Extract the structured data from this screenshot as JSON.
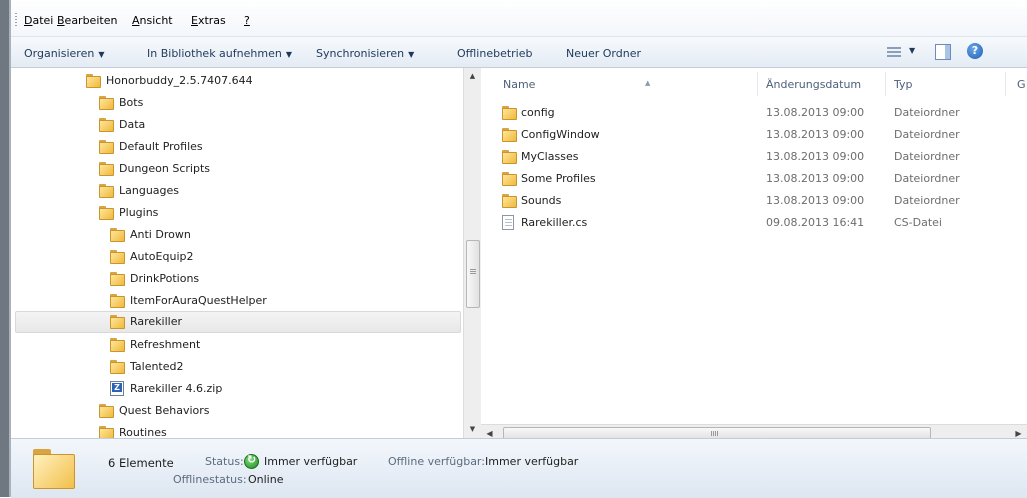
{
  "menubar": {
    "items": [
      {
        "label": "Datei",
        "ul": "D",
        "rest": "atei"
      },
      {
        "label": "Bearbeiten",
        "ul": "B",
        "rest": "earbeiten"
      },
      {
        "label": "Ansicht",
        "ul": "A",
        "rest": "nsicht"
      },
      {
        "label": "Extras",
        "ul": "E",
        "rest": "xtras"
      },
      {
        "label": "?",
        "ul": "?",
        "rest": ""
      }
    ]
  },
  "toolbar": {
    "organize": "Organisieren",
    "library": "In Bibliothek aufnehmen",
    "sync": "Synchronisieren",
    "offline": "Offlinebetrieb",
    "new_folder": "Neuer Ordner",
    "dropdown_arrow": "▼",
    "help": "?"
  },
  "tree": {
    "items": [
      {
        "label": "Honorbuddy_2.5.7407.644",
        "icon": "folder-icon"
      },
      {
        "label": "Bots",
        "icon": "folder-icon"
      },
      {
        "label": "Data",
        "icon": "folder-icon"
      },
      {
        "label": "Default Profiles",
        "icon": "folder-icon"
      },
      {
        "label": "Dungeon Scripts",
        "icon": "folder-icon"
      },
      {
        "label": "Languages",
        "icon": "folder-icon"
      },
      {
        "label": "Plugins",
        "icon": "folder-icon"
      },
      {
        "label": "Anti Drown",
        "icon": "folder-icon"
      },
      {
        "label": "AutoEquip2",
        "icon": "folder-icon"
      },
      {
        "label": "DrinkPotions",
        "icon": "folder-icon"
      },
      {
        "label": "ItemForAuraQuestHelper",
        "icon": "folder-icon"
      },
      {
        "label": "Rarekiller",
        "icon": "folder-icon",
        "selected": true
      },
      {
        "label": "Refreshment",
        "icon": "folder-icon"
      },
      {
        "label": "Talented2",
        "icon": "folder-icon"
      },
      {
        "label": "Rarekiller 4.6.zip",
        "icon": "zip-icon"
      },
      {
        "label": "Quest Behaviors",
        "icon": "folder-icon"
      },
      {
        "label": "Routines",
        "icon": "folder-icon"
      }
    ]
  },
  "details": {
    "columns": {
      "name": "Name",
      "date": "Änderungsdatum",
      "type": "Typ",
      "size": "G"
    },
    "rows": [
      {
        "name": "config",
        "date": "13.08.2013 09:00",
        "type": "Dateiordner",
        "icon": "folder-icon"
      },
      {
        "name": "ConfigWindow",
        "date": "13.08.2013 09:00",
        "type": "Dateiordner",
        "icon": "folder-icon"
      },
      {
        "name": "MyClasses",
        "date": "13.08.2013 09:00",
        "type": "Dateiordner",
        "icon": "folder-icon"
      },
      {
        "name": "Some Profiles",
        "date": "13.08.2013 09:00",
        "type": "Dateiordner",
        "icon": "folder-icon"
      },
      {
        "name": "Sounds",
        "date": "13.08.2013 09:00",
        "type": "Dateiordner",
        "icon": "folder-icon"
      },
      {
        "name": "Rarekiller.cs",
        "date": "09.08.2013 16:41",
        "type": "CS-Datei",
        "icon": "text-file-icon"
      }
    ]
  },
  "status": {
    "count": "6 Elemente",
    "status_label": "Status:",
    "status_value": "Immer verfügbar",
    "offline_avail_label": "Offline verfügbar:",
    "offline_avail_value": "Immer verfügbar",
    "offline_status_label": "Offlinestatus:",
    "offline_status_value": "Online"
  }
}
